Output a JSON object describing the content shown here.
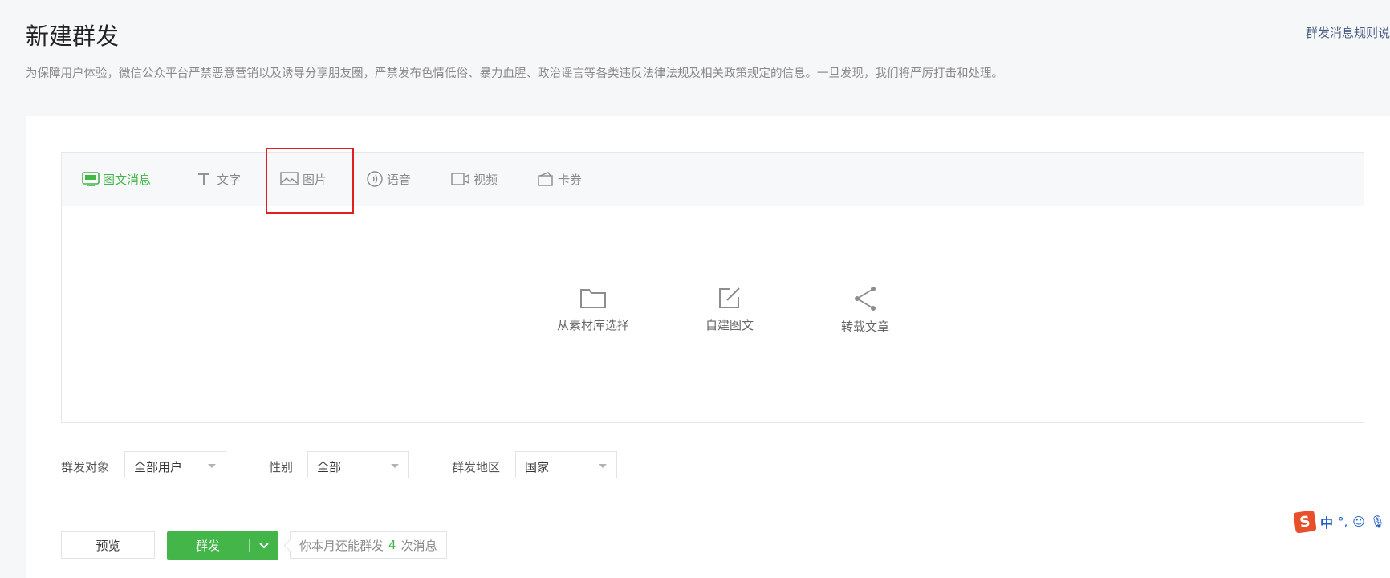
{
  "header": {
    "title": "新建群发",
    "rules_link": "群发消息规则说",
    "notice": "为保障用户体验，微信公众平台严禁恶意营销以及诱导分享朋友圈，严禁发布色情低俗、暴力血腥、政治谣言等各类违反法律法规及相关政策规定的信息。一旦发现，我们将严厉打击和处理。"
  },
  "tabs": [
    {
      "label": "图文消息",
      "icon": "article-icon",
      "active": true
    },
    {
      "label": "文字",
      "icon": "text-icon",
      "active": false
    },
    {
      "label": "图片",
      "icon": "image-icon",
      "active": false
    },
    {
      "label": "语音",
      "icon": "voice-icon",
      "active": false
    },
    {
      "label": "视频",
      "icon": "video-icon",
      "active": false
    },
    {
      "label": "卡券",
      "icon": "coupon-icon",
      "active": false
    }
  ],
  "create_options": [
    {
      "label": "从素材库选择",
      "icon": "folder-icon"
    },
    {
      "label": "自建图文",
      "icon": "edit-icon"
    },
    {
      "label": "转载文章",
      "icon": "share-icon"
    }
  ],
  "filters": {
    "target_label": "群发对象",
    "target_value": "全部用户",
    "gender_label": "性别",
    "gender_value": "全部",
    "region_label": "群发地区",
    "region_value": "国家"
  },
  "actions": {
    "preview_label": "预览",
    "send_label": "群发",
    "quota_prefix": "你本月还能群发",
    "quota_count": "4",
    "quota_suffix": "次消息"
  },
  "ime": {
    "logo": "S",
    "lang": "中"
  },
  "colors": {
    "accent": "#44b549",
    "highlight_box": "#e02020",
    "muted_text": "#8a8a8a"
  }
}
